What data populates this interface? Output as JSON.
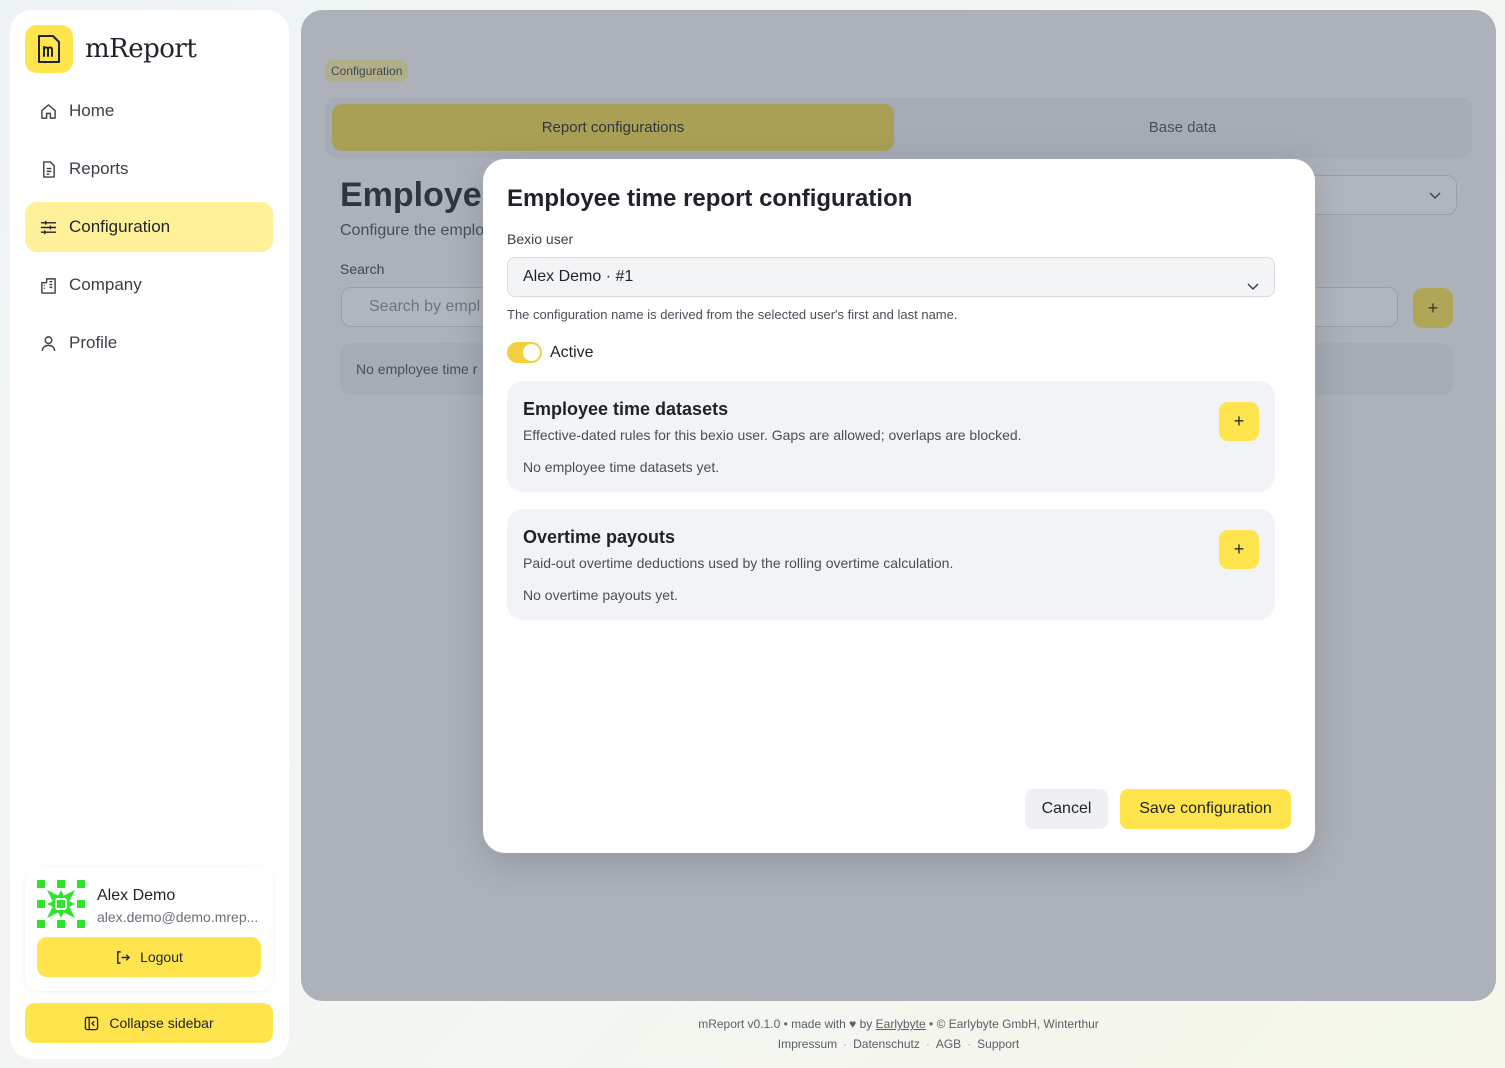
{
  "brand": {
    "name": "mReport"
  },
  "sidebar": {
    "items": [
      {
        "label": "Home",
        "icon": "home-icon"
      },
      {
        "label": "Reports",
        "icon": "document-icon"
      },
      {
        "label": "Configuration",
        "icon": "sliders-icon",
        "active": true
      },
      {
        "label": "Company",
        "icon": "building-icon"
      },
      {
        "label": "Profile",
        "icon": "user-icon"
      }
    ],
    "user": {
      "name": "Alex Demo",
      "email": "alex.demo@demo.mrep..."
    },
    "logout_label": "Logout",
    "collapse_label": "Collapse sidebar"
  },
  "main": {
    "breadcrumb": "Configuration",
    "tabs": [
      {
        "label": "Report configurations",
        "active": true
      },
      {
        "label": "Base data"
      }
    ],
    "title": "Employee",
    "subtitle": "Configure the emplo",
    "search_label": "Search",
    "search_placeholder": "Search by empl",
    "empty_text": "No employee time r"
  },
  "modal": {
    "title": "Employee time report configuration",
    "user_field_label": "Bexio user",
    "user_selected": "Alex Demo · #1",
    "hint": "The configuration name is derived from the selected user's first and last name.",
    "active_label": "Active",
    "sections": [
      {
        "title": "Employee time datasets",
        "description": "Effective-dated rules for this bexio user. Gaps are allowed; overlaps are blocked.",
        "empty": "No employee time datasets yet."
      },
      {
        "title": "Overtime payouts",
        "description": "Paid-out overtime deductions used by the rolling overtime calculation.",
        "empty": "No overtime payouts yet."
      }
    ],
    "cancel_label": "Cancel",
    "save_label": "Save configuration"
  },
  "footer": {
    "prefix": "mReport v0.1.0 • made with",
    "heart": "♥",
    "by": "by",
    "company_link": "Earlybyte",
    "suffix": "• © Earlybyte GmbH, Winterthur",
    "links": [
      "Impressum",
      "Datenschutz",
      "AGB",
      "Support"
    ]
  },
  "colors": {
    "accent": "#ffe44d",
    "active_nav": "#fff09a",
    "overlay": "#465064"
  }
}
